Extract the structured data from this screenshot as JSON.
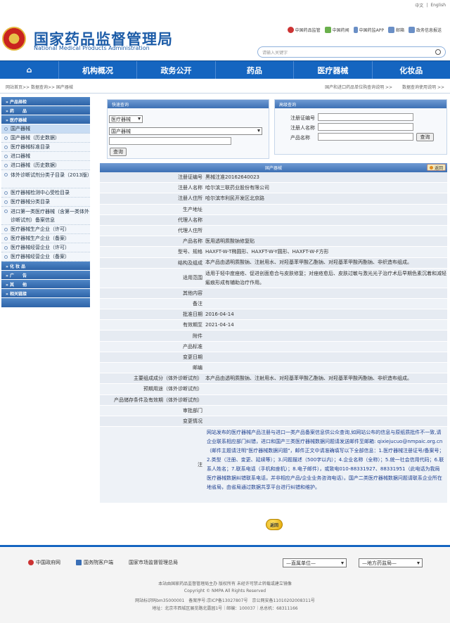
{
  "lang": {
    "cn": "中文",
    "en": "English",
    "sep": "|"
  },
  "header": {
    "title_cn": "国家药品监督管理局",
    "title_en": "National Medical Products Administration"
  },
  "quick_links": [
    "中国药品监管",
    "中国药闻",
    "中国药监APP",
    "邮箱",
    "政务信息报送"
  ],
  "search": {
    "placeholder": "请输入关键字"
  },
  "nav": {
    "home": "⌂",
    "items": [
      "机构概况",
      "政务公开",
      "药品",
      "医疗器械",
      "化妆品"
    ]
  },
  "breadcrumb": {
    "path": "网站首页>> 数据查询>> 国产器械",
    "right1": "国产和进口药品单位购查询说明 >>",
    "right2": "数据查询使用说明 >>"
  },
  "sidebar": {
    "heads": [
      "» 产品择检",
      "» 药　　品",
      "» 医疗器械"
    ],
    "items": [
      "国产器械",
      "国产器械（历史数据）",
      "医疗器械标准目录",
      "进口器械",
      "进口器械（历史数据）",
      "体外诊断试剂分类子目录（2013版）",
      "医疗器械检测中心受检目录",
      "医疗器械分类目录",
      "进口第一类医疗器械（含第一类体外诊断试剂）备案信息",
      "医疗器械生产企业（许可）",
      "医疗器械生产企业（备案）",
      "医疗器械经营企业（许可）",
      "医疗器械经营企业（备案）"
    ],
    "tail_heads": [
      "» 化 妆 品",
      "» 广　　告",
      "» 其　　他",
      "» 相关链接"
    ]
  },
  "quick_query": {
    "title": "快速查询",
    "select1": "医疗器械",
    "select2": "国产器械",
    "button": "查询"
  },
  "advanced_query": {
    "title": "高级查询",
    "labels": [
      "注册证编号",
      "注册人名称",
      "产品名称"
    ],
    "button": "查询"
  },
  "detail": {
    "title": "国产器械",
    "back_tag": "返回",
    "rows": [
      {
        "k": "注册证编号",
        "v": "黑械注准20162640023"
      },
      {
        "k": "注册人名称",
        "v": "哈尔滨三联药业股份有限公司"
      },
      {
        "k": "注册人住所",
        "v": "哈尔滨市利民开发区北京路"
      },
      {
        "k": "生产地址",
        "v": ""
      },
      {
        "k": "代理人名称",
        "v": ""
      },
      {
        "k": "代理人住所",
        "v": ""
      },
      {
        "k": "产品名称",
        "v": "医用透明质酸钠修复贴"
      },
      {
        "k": "型号、规格",
        "v": "HAXFT-W-T椭圆形、HAXFT-W-Y圆形、HAXFT-W-F方形"
      },
      {
        "k": "结构及组成",
        "v": "本产品由透明质酸钠、注射用水、对羟基苯甲酸乙酯钠、对羟基苯甲酸丙酯钠、非织造布组成。"
      },
      {
        "k": "适用范围",
        "v": "适用于轻中度痤疮、促进创面愈合与皮肤修复；对痤疮愈后、皮肤过敏与激光光子治疗术后早期色素沉着和减轻瘢痕形成有辅助治疗作用。",
        "h": 2
      },
      {
        "k": "其他内容",
        "v": ""
      },
      {
        "k": "备注",
        "v": ""
      },
      {
        "k": "批准日期",
        "v": "2016-04-14"
      },
      {
        "k": "有效期至",
        "v": "2021-04-14"
      },
      {
        "k": "附件",
        "v": ""
      },
      {
        "k": "产品标准",
        "v": ""
      },
      {
        "k": "变更日期",
        "v": ""
      },
      {
        "k": "邮编",
        "v": ""
      },
      {
        "k": "主要组成成分（体外诊断试剂）",
        "v": "本产品由透明质酸钠、注射用水、对羟基苯甲酸乙酯钠、对羟基苯甲酸丙酯钠、非织造布组成。"
      },
      {
        "k": "预期用途（体外诊断试剂）",
        "v": ""
      },
      {
        "k": "产品储存条件及有效期（体外诊断试剂）",
        "v": ""
      },
      {
        "k": "审批部门",
        "v": ""
      },
      {
        "k": "变更情况",
        "v": ""
      }
    ],
    "note_key": "注",
    "note": "网站发布的医疗器械产品注册与进口一类产品备案信息供公众查询,如网站公布的信息与原纸质批件不一致,请企业联系相应部门纠错，进口和国产三类医疗器械数据问题请发送邮件至邮箱: qixiejucuo@nmpaic.org.cn （邮件主题请注明\"医疗器械数据问题\"，邮件正文中请准确填写以下全部信息：1.医疗器械注册证号/备案号；2.类型（注册、变更、延续等）；3.问题描述（500字以内）；4.企业名称（全称）；5.统一社会信用代码；6.联系人姓名；7.联系电话（手机和座机）；8.电子邮件），或致电010-88331927、88331951（此电话为我局医疗器械数据纠错联系电话，并非相应产品/企业业务咨询电话）。国产二类医疗器械数据问题请联系企业所在地省局，由省局通过数据共享平台进行纠错和维护。",
    "back_button": "返回"
  },
  "footer": {
    "links": [
      "中国政府网",
      "国务院客户端",
      "国家市场监督管理总局"
    ],
    "select1": "—直属单位—",
    "select2": "—地方药监局—",
    "line1": "本站由国家药品监督管理局主办 版权所有 未经许可禁止转载或建立镜像",
    "line2": "Copyright © NMPA All Rights Reserved",
    "line3": "网站标识码bm35000001　备案序号:京ICP备13027807号　京公网安备11010202008311号",
    "line4": "地址：北京市西城区展览路北露园1号｜邮编：100037｜总总机：68311166"
  }
}
